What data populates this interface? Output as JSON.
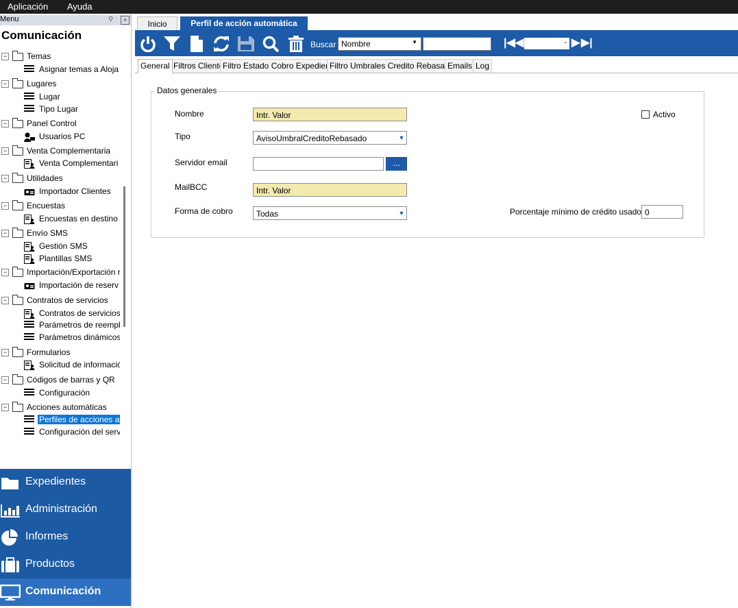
{
  "menubar": {
    "items": [
      "Aplicación",
      "Ayuda"
    ]
  },
  "left_panel": {
    "header": "Menu",
    "section_title": "Comunicación",
    "tree": [
      {
        "label": "Temas",
        "children": [
          {
            "label": "Asignar temas a Aloja",
            "icon": "list-icon"
          }
        ]
      },
      {
        "label": "Lugares",
        "children": [
          {
            "label": "Lugar",
            "icon": "list-icon"
          },
          {
            "label": "Tipo Lugar",
            "icon": "list-icon"
          }
        ]
      },
      {
        "label": "Panel Control",
        "children": [
          {
            "label": "Usuarios PC",
            "icon": "user-pc-icon"
          }
        ]
      },
      {
        "label": "Venta Complementaria",
        "children": [
          {
            "label": "Venta Complementari",
            "icon": "form-user-icon"
          }
        ]
      },
      {
        "label": "Utilidades",
        "children": [
          {
            "label": "Importador Clientes",
            "icon": "id-card-icon"
          }
        ]
      },
      {
        "label": "Encuestas",
        "children": [
          {
            "label": "Encuestas en destino",
            "icon": "form-user-icon"
          }
        ]
      },
      {
        "label": "Envío SMS",
        "children": [
          {
            "label": "Gestión SMS",
            "icon": "form-user-icon"
          },
          {
            "label": "Plantillas SMS",
            "icon": "form-user-icon"
          }
        ]
      },
      {
        "label": "Importación/Exportación r",
        "children": [
          {
            "label": "Importación de reserv",
            "icon": "id-card-icon"
          }
        ]
      },
      {
        "label": "Contratos de servicios",
        "children": [
          {
            "label": "Contratos de servicios",
            "icon": "form-user-icon"
          },
          {
            "label": "Parámetros de reempl",
            "icon": "list-icon"
          },
          {
            "label": "Parámetros dinámicos",
            "icon": "list-icon"
          }
        ]
      },
      {
        "label": "Formularios",
        "children": [
          {
            "label": "Solicitud de informació",
            "icon": "form-user-icon"
          }
        ]
      },
      {
        "label": "Códigos de barras y QR",
        "children": [
          {
            "label": "Configuración",
            "icon": "list-icon"
          }
        ]
      },
      {
        "label": "Acciones automáticas",
        "children": [
          {
            "label": "Perfiles de acciones a",
            "icon": "list-icon",
            "selected": true
          },
          {
            "label": "Configuración del servi",
            "icon": "list-icon"
          }
        ]
      }
    ],
    "nav_buttons": [
      {
        "label": "Expedientes",
        "icon": "folder-icon"
      },
      {
        "label": "Administración",
        "icon": "bar-chart-icon"
      },
      {
        "label": "Informes",
        "icon": "pie-chart-icon"
      },
      {
        "label": "Productos",
        "icon": "briefcase-icon"
      },
      {
        "label": "Comunicación",
        "icon": "monitor-icon",
        "active": true
      }
    ]
  },
  "doc_tabs": {
    "inicio": "Inicio",
    "perfil": "Perfil de acción automática"
  },
  "toolbar": {
    "buscar_label": "Buscar",
    "buscar_selected": "Nombre",
    "buscar_value": "",
    "nav_value": "-"
  },
  "sub_tabs": [
    "General",
    "Filtros Cliente",
    "Filtro Estado Cobro Expediente",
    "Filtro Umbrales Credito Rebasado",
    "Emails",
    "Log"
  ],
  "form": {
    "group_title": "Datos generales",
    "nombre_label": "Nombre",
    "nombre_value": "Intr. Valor",
    "tipo_label": "Tipo",
    "tipo_value": "AvisoUmbralCreditoRebasado",
    "servidor_label": "Servidor email",
    "servidor_value": "",
    "dots_label": "...",
    "mailbcc_label": "MailBCC",
    "mailbcc_value": "Intr. Valor",
    "forma_cobro_label": "Forma de cobro",
    "forma_cobro_value": "Todas",
    "activo_label": "Activo",
    "activo_checked": false,
    "porcentaje_label": "Porcentaje mínimo de crédito usado",
    "porcentaje_value": "0"
  }
}
